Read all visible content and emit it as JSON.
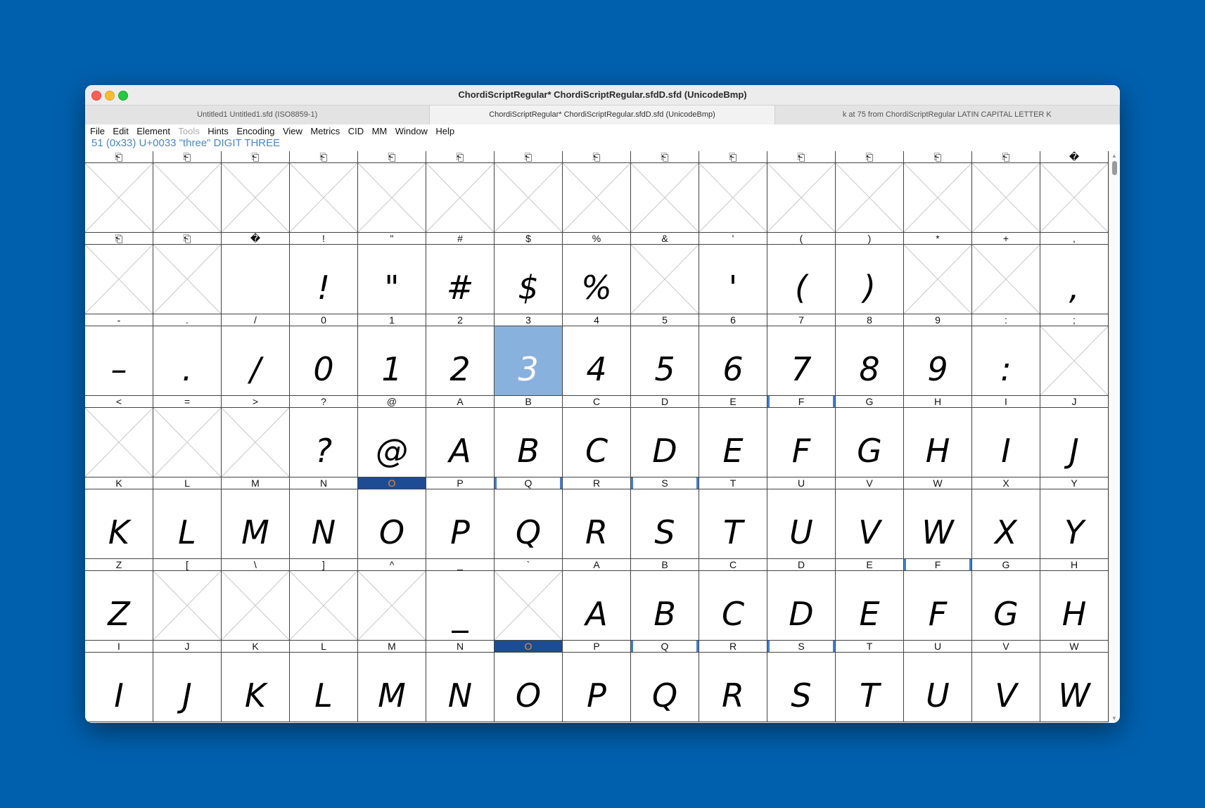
{
  "window": {
    "title": "ChordiScriptRegular*  ChordiScriptRegular.sfdD.sfd (UnicodeBmp)",
    "tabs": [
      {
        "label": "Untitled1  Untitled1.sfd (ISO8859-1)"
      },
      {
        "label": "ChordiScriptRegular*  ChordiScriptRegular.sfdD.sfd (UnicodeBmp)"
      },
      {
        "label": "k at 75 from ChordiScriptRegular LATIN CAPITAL LETTER K"
      }
    ],
    "active_tab": 1
  },
  "menu": {
    "items": [
      "File",
      "Edit",
      "Element",
      "Tools",
      "Hints",
      "Encoding",
      "View",
      "Metrics",
      "CID",
      "MM",
      "Window",
      "Help"
    ],
    "disabled": [
      "Tools"
    ]
  },
  "status": {
    "text": "51 (0x33) U+0033 \"three\" DIGIT THREE"
  },
  "colors": {
    "selected_fill": "#89b1de",
    "highlight_label_bg": "#1e4c92",
    "highlight_label_fg": "#f08a3c",
    "status_text": "#4d86c8",
    "desktop": "#0060ae"
  },
  "grid": {
    "rows": [
      {
        "cells": [
          {
            "label": "⎗",
            "glyph": ""
          },
          {
            "label": "⎗",
            "glyph": ""
          },
          {
            "label": "⎗",
            "glyph": ""
          },
          {
            "label": "⎗",
            "glyph": ""
          },
          {
            "label": "⎗",
            "glyph": ""
          },
          {
            "label": "⎗",
            "glyph": ""
          },
          {
            "label": "⎗",
            "glyph": ""
          },
          {
            "label": "⎗",
            "glyph": ""
          },
          {
            "label": "⎗",
            "glyph": ""
          },
          {
            "label": "⎗",
            "glyph": ""
          },
          {
            "label": "⎗",
            "glyph": ""
          },
          {
            "label": "⎗",
            "glyph": ""
          },
          {
            "label": "⎗",
            "glyph": ""
          },
          {
            "label": "⎗",
            "glyph": ""
          },
          {
            "label": "�",
            "glyph": ""
          }
        ]
      },
      {
        "cells": [
          {
            "label": "⎗",
            "glyph": ""
          },
          {
            "label": "⎗",
            "glyph": ""
          },
          {
            "label": "�",
            "glyph": "",
            "blank": true
          },
          {
            "label": "!",
            "glyph": "!"
          },
          {
            "label": "\"",
            "glyph": "\""
          },
          {
            "label": "#",
            "glyph": "#"
          },
          {
            "label": "$",
            "glyph": "$"
          },
          {
            "label": "%",
            "glyph": "%"
          },
          {
            "label": "&",
            "glyph": ""
          },
          {
            "label": "'",
            "glyph": "'"
          },
          {
            "label": "(",
            "glyph": "("
          },
          {
            "label": ")",
            "glyph": ")"
          },
          {
            "label": "*",
            "glyph": ""
          },
          {
            "label": "+",
            "glyph": ""
          },
          {
            "label": ",",
            "glyph": ","
          }
        ]
      },
      {
        "cells": [
          {
            "label": "-",
            "glyph": "–"
          },
          {
            "label": ".",
            "glyph": "."
          },
          {
            "label": "/",
            "glyph": "/"
          },
          {
            "label": "0",
            "glyph": "0"
          },
          {
            "label": "1",
            "glyph": "1"
          },
          {
            "label": "2",
            "glyph": "2"
          },
          {
            "label": "3",
            "glyph": "3",
            "selected": true
          },
          {
            "label": "4",
            "glyph": "4"
          },
          {
            "label": "5",
            "glyph": "5"
          },
          {
            "label": "6",
            "glyph": "6"
          },
          {
            "label": "7",
            "glyph": "7"
          },
          {
            "label": "8",
            "glyph": "8"
          },
          {
            "label": "9",
            "glyph": "9"
          },
          {
            "label": ":",
            "glyph": ":"
          },
          {
            "label": ";",
            "glyph": ""
          }
        ]
      },
      {
        "cells": [
          {
            "label": "<",
            "glyph": ""
          },
          {
            "label": "=",
            "glyph": ""
          },
          {
            "label": ">",
            "glyph": ""
          },
          {
            "label": "?",
            "glyph": "?"
          },
          {
            "label": "@",
            "glyph": "@"
          },
          {
            "label": "A",
            "glyph": "A"
          },
          {
            "label": "B",
            "glyph": "B"
          },
          {
            "label": "C",
            "glyph": "C"
          },
          {
            "label": "D",
            "glyph": "D"
          },
          {
            "label": "E",
            "glyph": "E"
          },
          {
            "label": "F",
            "glyph": "F",
            "mark": "both"
          },
          {
            "label": "G",
            "glyph": "G"
          },
          {
            "label": "H",
            "glyph": "H"
          },
          {
            "label": "I",
            "glyph": "I"
          },
          {
            "label": "J",
            "glyph": "J"
          }
        ]
      },
      {
        "cells": [
          {
            "label": "K",
            "glyph": "K"
          },
          {
            "label": "L",
            "glyph": "L"
          },
          {
            "label": "M",
            "glyph": "M"
          },
          {
            "label": "N",
            "glyph": "N"
          },
          {
            "label": "O",
            "glyph": "O",
            "hl": true
          },
          {
            "label": "P",
            "glyph": "P"
          },
          {
            "label": "Q",
            "glyph": "Q",
            "mark": "both"
          },
          {
            "label": "R",
            "glyph": "R"
          },
          {
            "label": "S",
            "glyph": "S",
            "mark": "both"
          },
          {
            "label": "T",
            "glyph": "T"
          },
          {
            "label": "U",
            "glyph": "U"
          },
          {
            "label": "V",
            "glyph": "V"
          },
          {
            "label": "W",
            "glyph": "W"
          },
          {
            "label": "X",
            "glyph": "X"
          },
          {
            "label": "Y",
            "glyph": "Y"
          }
        ]
      },
      {
        "cells": [
          {
            "label": "Z",
            "glyph": "Z"
          },
          {
            "label": "[",
            "glyph": ""
          },
          {
            "label": "\\",
            "glyph": ""
          },
          {
            "label": "]",
            "glyph": ""
          },
          {
            "label": "^",
            "glyph": ""
          },
          {
            "label": "_",
            "glyph": "_"
          },
          {
            "label": "`",
            "glyph": ""
          },
          {
            "label": "A",
            "glyph": "A"
          },
          {
            "label": "B",
            "glyph": "B"
          },
          {
            "label": "C",
            "glyph": "C"
          },
          {
            "label": "D",
            "glyph": "D"
          },
          {
            "label": "E",
            "glyph": "E"
          },
          {
            "label": "F",
            "glyph": "F",
            "mark": "both"
          },
          {
            "label": "G",
            "glyph": "G"
          },
          {
            "label": "H",
            "glyph": "H"
          }
        ]
      },
      {
        "cells": [
          {
            "label": "I",
            "glyph": "I"
          },
          {
            "label": "J",
            "glyph": "J"
          },
          {
            "label": "K",
            "glyph": "K"
          },
          {
            "label": "L",
            "glyph": "L"
          },
          {
            "label": "M",
            "glyph": "M"
          },
          {
            "label": "N",
            "glyph": "N"
          },
          {
            "label": "O",
            "glyph": "O",
            "hl": true
          },
          {
            "label": "P",
            "glyph": "P"
          },
          {
            "label": "Q",
            "glyph": "Q",
            "mark": "both"
          },
          {
            "label": "R",
            "glyph": "R"
          },
          {
            "label": "S",
            "glyph": "S",
            "mark": "both"
          },
          {
            "label": "T",
            "glyph": "T"
          },
          {
            "label": "U",
            "glyph": "U"
          },
          {
            "label": "V",
            "glyph": "V"
          },
          {
            "label": "W",
            "glyph": "W"
          }
        ]
      }
    ]
  }
}
